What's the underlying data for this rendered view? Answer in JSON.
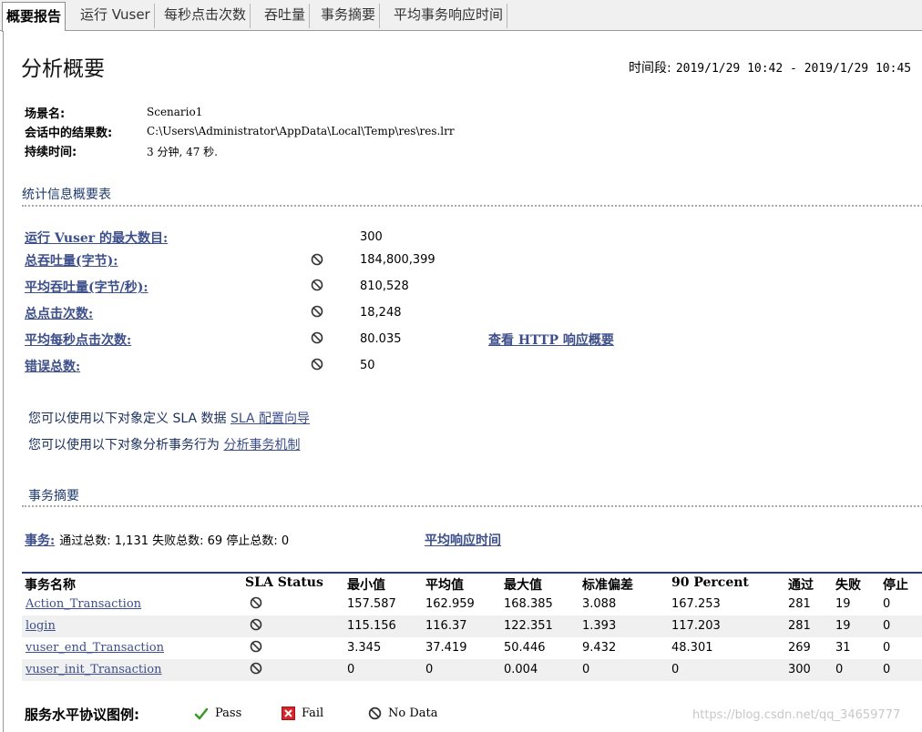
{
  "tabs": [
    "概要报告",
    "运行 Vuser",
    "每秒点击次数",
    "吞吐量",
    "事务摘要",
    "平均事务响应时间"
  ],
  "header": {
    "title": "分析概要",
    "period_label": "时间段:",
    "period_value": "2019/1/29 10:42 - 2019/1/29 10:45"
  },
  "scenario": {
    "name_label": "场景名:",
    "name_value": "Scenario1",
    "results_label": "会话中的结果数:",
    "results_value": "C:\\Users\\Administrator\\AppData\\Local\\Temp\\res\\res.lrr",
    "duration_label": "持续时间:",
    "duration_value": "3 分钟, 47 秒."
  },
  "stats": {
    "section_title": "统计信息概要表",
    "rows": [
      {
        "label": "运行 Vuser 的最大数目:",
        "value": "300",
        "icon": "none"
      },
      {
        "label": "总吞吐量(字节):",
        "value": "184,800,399",
        "icon": "no-data-icon"
      },
      {
        "label": "平均吞吐量(字节/秒):",
        "value": "810,528",
        "icon": "no-data-icon"
      },
      {
        "label": "总点击次数:",
        "value": "18,248",
        "icon": "no-data-icon"
      },
      {
        "label": "平均每秒点击次数:",
        "value": "80.035",
        "icon": "no-data-icon"
      },
      {
        "label": "错误总数:",
        "value": "50",
        "icon": "no-data-icon"
      }
    ],
    "http_link": "查看 HTTP 响应概要"
  },
  "hints": {
    "sla_text": "您可以使用以下对象定义 SLA 数据",
    "sla_link": "SLA 配置向导",
    "analyze_text": "您可以使用以下对象分析事务行为",
    "analyze_link": "分析事务机制"
  },
  "transactions": {
    "section_title": "事务摘要",
    "summary_link": "事务:",
    "summary_text": "通过总数: 1,131 失败总数: 69 停止总数: 0",
    "avg_link": "平均响应时间",
    "columns": [
      "事务名称",
      "SLA Status",
      "最小值",
      "平均值",
      "最大值",
      "标准偏差",
      "90 Percent",
      "通过",
      "失败",
      "停止"
    ],
    "rows": [
      {
        "name": "Action_Transaction",
        "min": "157.587",
        "avg": "162.959",
        "max": "168.385",
        "std": "3.088",
        "p90": "167.253",
        "pass": "281",
        "fail": "19",
        "stop": "0"
      },
      {
        "name": "login",
        "min": "115.156",
        "avg": "116.37",
        "max": "122.351",
        "std": "1.393",
        "p90": "117.203",
        "pass": "281",
        "fail": "19",
        "stop": "0"
      },
      {
        "name": "vuser_end_Transaction",
        "min": "3.345",
        "avg": "37.419",
        "max": "50.446",
        "std": "9.432",
        "p90": "48.301",
        "pass": "269",
        "fail": "31",
        "stop": "0"
      },
      {
        "name": "vuser_init_Transaction",
        "min": "0",
        "avg": "0",
        "max": "0.004",
        "std": "0",
        "p90": "0",
        "pass": "300",
        "fail": "0",
        "stop": "0"
      }
    ]
  },
  "legend": {
    "label": "服务水平协议图例:",
    "pass": "Pass",
    "fail": "Fail",
    "nodata": "No Data"
  },
  "watermark": "https://blog.csdn.net/qq_34659777",
  "colors": {
    "link": "#3d4f8a",
    "table_rule": "#2b3e73",
    "pass": "#3a9a2a",
    "fail": "#d8252b"
  }
}
